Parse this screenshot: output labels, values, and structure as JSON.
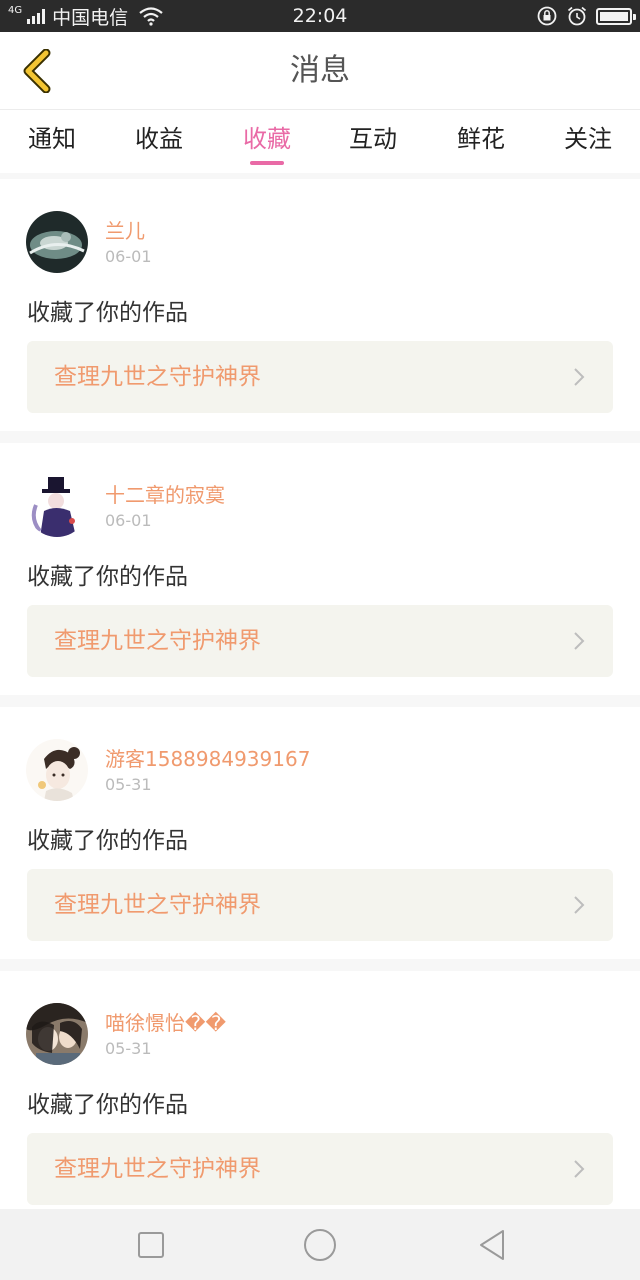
{
  "status_bar": {
    "network_type": "4G",
    "carrier": "中国电信",
    "time": "22:04",
    "icons": [
      "signal-icon",
      "wifi-icon",
      "rotation-lock-icon",
      "alarm-icon",
      "battery-icon"
    ],
    "battery_level": 0.9
  },
  "header": {
    "title": "消息",
    "back_icon": "chevron-left-icon"
  },
  "tabs": [
    {
      "label": "通知",
      "active": false
    },
    {
      "label": "收益",
      "active": false
    },
    {
      "label": "收藏",
      "active": true
    },
    {
      "label": "互动",
      "active": false
    },
    {
      "label": "鲜花",
      "active": false
    },
    {
      "label": "关注",
      "active": false
    }
  ],
  "messages": [
    {
      "username": "兰儿",
      "date": "06-01",
      "action": "收藏了你的作品",
      "work_title": "查理九世之守护神界"
    },
    {
      "username": "十二章的寂寞",
      "date": "06-01",
      "action": "收藏了你的作品",
      "work_title": "查理九世之守护神界"
    },
    {
      "username": "游客1588984939167",
      "date": "05-31",
      "action": "收藏了你的作品",
      "work_title": "查理九世之守护神界"
    },
    {
      "username": "喵徐憬怡��",
      "date": "05-31",
      "action": "收藏了你的作品",
      "work_title": "查理九世之守护神界"
    }
  ],
  "nav_bar": {
    "icons": [
      "square-recents-icon",
      "circle-home-icon",
      "triangle-back-icon"
    ]
  },
  "colors": {
    "accent_pink": "#e96aa6",
    "name_orange": "#f09a6e",
    "card_bg": "#f4f4ee",
    "back_arrow_yellow": "#f3c533"
  }
}
